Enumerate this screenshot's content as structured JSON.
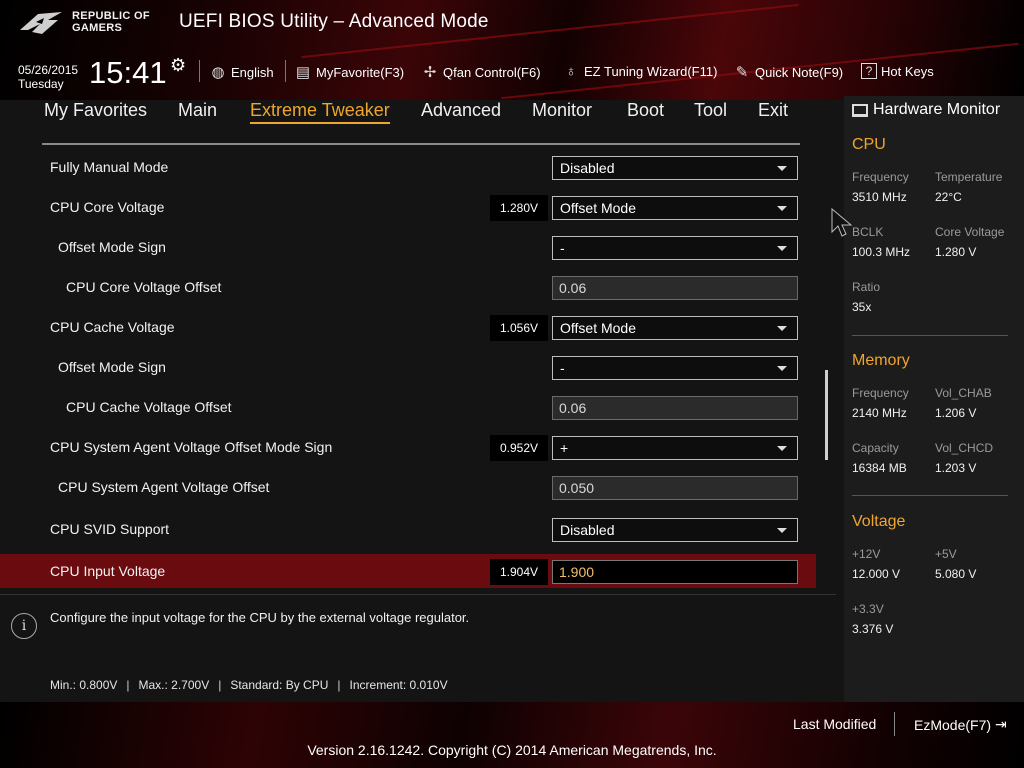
{
  "header": {
    "logo_line1": "REPUBLIC OF",
    "logo_line2": "GAMERS",
    "title": "UEFI BIOS Utility – Advanced Mode",
    "date": "05/26/2015",
    "weekday": "Tuesday",
    "time": "15:41",
    "tools": [
      {
        "label": "English",
        "icon": "globe-icon"
      },
      {
        "label": "MyFavorite(F3)",
        "icon": "favorite-icon"
      },
      {
        "label": "Qfan Control(F6)",
        "icon": "fan-icon"
      },
      {
        "label": "EZ Tuning Wizard(F11)",
        "icon": "bulb-icon"
      },
      {
        "label": "Quick Note(F9)",
        "icon": "note-icon"
      },
      {
        "label": "Hot Keys",
        "icon": "question-icon"
      }
    ]
  },
  "tabs": [
    "My Favorites",
    "Main",
    "Extreme Tweaker",
    "Advanced",
    "Monitor",
    "Boot",
    "Tool",
    "Exit"
  ],
  "active_tab": "Extreme Tweaker",
  "settings": [
    {
      "label": "Fully Manual Mode",
      "current": "",
      "type": "select",
      "value": "Disabled"
    },
    {
      "label": "CPU Core Voltage",
      "current": "1.280V",
      "type": "select",
      "value": "Offset Mode"
    },
    {
      "label": "Offset Mode Sign",
      "current": "",
      "type": "select",
      "value": "-"
    },
    {
      "label": "CPU Core Voltage Offset",
      "current": "",
      "type": "text",
      "value": "0.06"
    },
    {
      "label": "CPU Cache Voltage",
      "current": "1.056V",
      "type": "select",
      "value": "Offset Mode"
    },
    {
      "label": "Offset Mode Sign",
      "current": "",
      "type": "select",
      "value": "-"
    },
    {
      "label": "CPU Cache Voltage Offset",
      "current": "",
      "type": "text",
      "value": "0.06"
    },
    {
      "label": "CPU System Agent Voltage Offset Mode Sign",
      "current": "0.952V",
      "type": "select",
      "value": "+"
    },
    {
      "label": "CPU System Agent Voltage Offset",
      "current": "",
      "type": "text",
      "value": "0.050"
    },
    {
      "label": "CPU SVID Support",
      "current": "",
      "type": "select",
      "value": "Disabled"
    },
    {
      "label": "CPU Input Voltage",
      "current": "1.904V",
      "type": "text",
      "value": "1.900"
    }
  ],
  "help": {
    "text": "Configure the input voltage for the CPU by the external voltage regulator.",
    "min": "Min.: 0.800V",
    "max": "Max.: 2.700V",
    "standard": "Standard: By CPU",
    "increment": "Increment: 0.010V"
  },
  "hardware_monitor": {
    "title": "Hardware Monitor",
    "cpu": {
      "heading": "CPU",
      "frequency_label": "Frequency",
      "frequency": "3510 MHz",
      "temperature_label": "Temperature",
      "temperature": "22°C",
      "bclk_label": "BCLK",
      "bclk": "100.3 MHz",
      "core_voltage_label": "Core Voltage",
      "core_voltage": "1.280 V",
      "ratio_label": "Ratio",
      "ratio": "35x"
    },
    "memory": {
      "heading": "Memory",
      "frequency_label": "Frequency",
      "frequency": "2140 MHz",
      "vol_chab_label": "Vol_CHAB",
      "vol_chab": "1.206 V",
      "capacity_label": "Capacity",
      "capacity": "16384 MB",
      "vol_chcd_label": "Vol_CHCD",
      "vol_chcd": "1.203 V"
    },
    "voltage": {
      "heading": "Voltage",
      "v12_label": "+12V",
      "v12": "12.000 V",
      "v5_label": "+5V",
      "v5": "5.080 V",
      "v33_label": "+3.3V",
      "v33": "3.376 V"
    }
  },
  "footer": {
    "last_modified": "Last Modified",
    "ez_mode": "EzMode(F7)",
    "copyright": "Version 2.16.1242. Copyright (C) 2014 American Megatrends, Inc."
  },
  "colors": {
    "accent": "#f0a52c",
    "selected_row": "#6a0b0f",
    "brand_red": "#8a0c10"
  }
}
